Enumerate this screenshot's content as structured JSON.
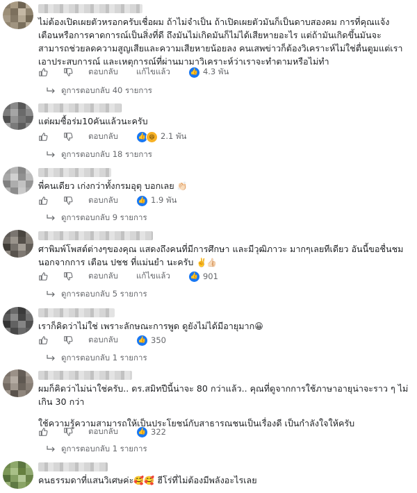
{
  "ui": {
    "reply_label": "ตอบกลับ",
    "edited_label": "แก้ไขแล้ว"
  },
  "icons": {
    "like": "thumbs-up-icon",
    "dislike": "thumbs-down-icon",
    "reply_arrow": "reply-arrow-icon"
  },
  "colors": {
    "like_blue": "#1877f2",
    "haha_yellow": "#f7b125",
    "love_red": "#f33e58",
    "meta_gray": "#65676b"
  },
  "comments": [
    {
      "text": [
        "ไม่ต้องเปิดเผยตัวหรอกครับเชื่อผม ถ้าไม่จำเป็น ถ้าเปิดเผยตัวมันก็เป็นดาบสองคม การที่คุณแจ้ง เตือนหรือการคาดการณ์เป็นสิ่งที่ดี ถึงมันไม่เกิดมันก็ไม่ได้เสียหายอะไร แต่ถ้ามันเกิดขึ้นมันจะ สามารถช่วยลดความสูญเสียและความเสียหายน้อยลง คนเสพข่าวก็ต้องวิเคราะห์ไม่ใช่ตื่นตูมแต่เรา เอาประสบการณ์ และเหตุการณ์ที่ผ่านมามาวิเคราะห์ว่าเราจะทำตามหรือไม่ทำ"
      ],
      "edited": true,
      "reaction_count": "4.3 พัน",
      "replies": "ดูการตอบกลับ 40 รายการ"
    },
    {
      "text": [
        "แต่ผมซื้อร่ม10คันแล้วนะครับ"
      ],
      "edited": false,
      "reaction_count": "2.1 พัน",
      "replies": "ดูการตอบกลับ 18 รายการ"
    },
    {
      "text": [
        "พี่คนเดียว เก่งกว่าทั้งกรมอุตุ บอกเลย"
      ],
      "emoji": "👏🏻",
      "edited": false,
      "reaction_count": "1.9 พัน",
      "replies": "ดูการตอบกลับ 9 รายการ"
    },
    {
      "text": [
        "ศาพิมพ์โพสต์ต่างๆของคุณ แสดงถึงคนที่มีการศึกษา และมีวุฒิภาวะ มากๆเลยทีเดียว อันนี้ขอชื่นชม นอกจากการ เตือน ปชช ที่แม่นยำ นะครับ"
      ],
      "emoji": "✌️👍🏻",
      "edited": true,
      "reaction_count": "901",
      "replies": "ดูการตอบกลับ 5 รายการ"
    },
    {
      "text": [
        "เราก็คิดว่าไม่ใช่ เพราะลักษณะการพูด ดูยังไม่ได้มีอายุมาก"
      ],
      "emoji": "😀",
      "edited": false,
      "reaction_count": "350",
      "replies": "ดูการตอบกลับ 1 รายการ"
    },
    {
      "text": [
        "ผมก็คิดว่าไม่น่าใช่ครับ.. ดร.สมิทปีนี้น่าจะ 80 กว่าแล้ว.. คุณที่ดูจากการใช้ภาษาอายุน่าจะราว ๆ ไม่ เกิน 30 กว่า",
        "ใช้ความรู้ความสามารถให้เป็นประโยชน์กับสาธารณชนเป็นเรื่องดี เป็นกำลังใจให้ครับ"
      ],
      "edited": false,
      "reaction_count": "322",
      "replies": "ดูการตอบกลับ 1 รายการ"
    },
    {
      "text": [
        "คนธรรมดาที่แสนวิเศษค่ะ"
      ],
      "emoji": "🥰🥰",
      "text_after": " ฮีโร่ที่ไม่ต้องมีพลังอะไรเลย"
    }
  ]
}
